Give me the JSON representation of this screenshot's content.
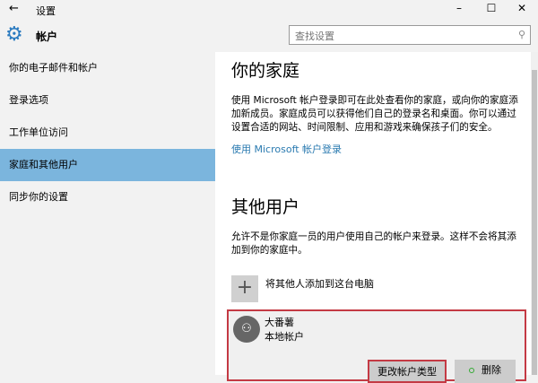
{
  "window": {
    "title": "设置",
    "minimize": "–",
    "maximize": "☐",
    "close": "✕"
  },
  "header": {
    "title": "帐户",
    "search_placeholder": "查找设置"
  },
  "sidebar": {
    "items": [
      {
        "label": "你的电子邮件和帐户"
      },
      {
        "label": "登录选项"
      },
      {
        "label": "工作单位访问"
      },
      {
        "label": "家庭和其他用户"
      },
      {
        "label": "同步你的设置"
      }
    ],
    "active_index": 3
  },
  "family": {
    "title": "你的家庭",
    "description": "使用 Microsoft 帐户登录即可在此处查看你的家庭，或向你的家庭添加新成员。家庭成员可以获得他们自己的登录名和桌面。你可以通过设置合适的网站、时间限制、应用和游戏来确保孩子们的安全。",
    "link": "使用 Microsoft 帐户登录"
  },
  "others": {
    "title": "其他用户",
    "description": "允许不是你家庭一员的用户使用自己的帐户来登录。这样不会将其添加到你的家庭中。",
    "add_label": "将其他人添加到这台电脑",
    "user": {
      "name": "大番薯",
      "type": "本地帐户",
      "change_type": "更改帐户类型",
      "delete": "删除"
    }
  },
  "colors": {
    "accent": "#7bb5dd",
    "highlight": "#c43a44",
    "link": "#2a7ab0"
  }
}
